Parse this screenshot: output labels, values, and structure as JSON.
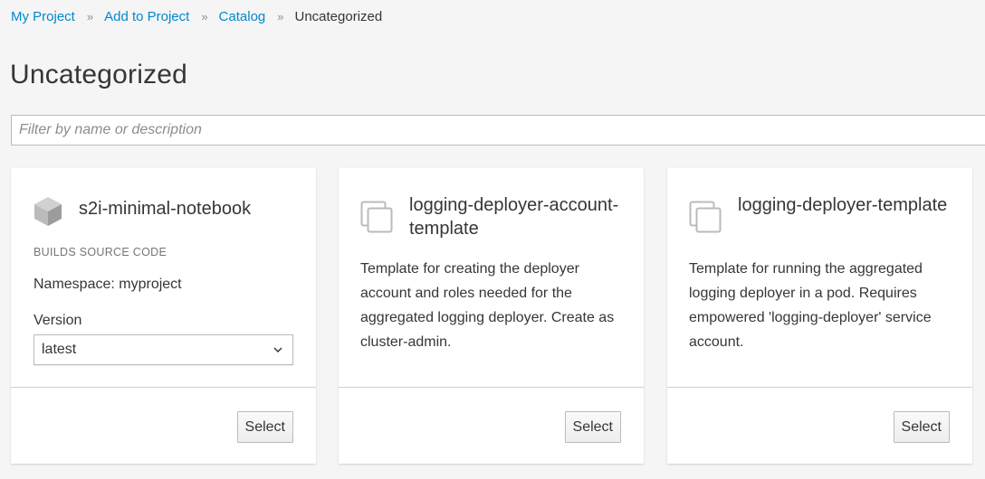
{
  "breadcrumb": {
    "items": [
      "My Project",
      "Add to Project",
      "Catalog"
    ],
    "current": "Uncategorized",
    "separator": "»"
  },
  "page": {
    "title": "Uncategorized"
  },
  "filter": {
    "placeholder": "Filter by name or description",
    "value": ""
  },
  "cards": [
    {
      "icon": "cube-icon",
      "title": "s2i-minimal-notebook",
      "tag": "BUILDS SOURCE CODE",
      "namespace": "Namespace: myproject",
      "version_label": "Version",
      "version_value": "latest",
      "button": "Select"
    },
    {
      "icon": "template-icon",
      "title": "logging-deployer-account-template",
      "description": "Template for creating the deployer account and roles needed for the aggregated logging deployer. Create as cluster-admin.",
      "button": "Select"
    },
    {
      "icon": "template-icon",
      "title": "logging-deployer-template",
      "description": "Template for running the aggregated logging deployer in a pod. Requires empowered 'logging-deployer' service account.",
      "button": "Select"
    }
  ],
  "colors": {
    "link": "#0088ce",
    "text": "#363636",
    "muted": "#72767b",
    "background": "#f5f5f5"
  }
}
